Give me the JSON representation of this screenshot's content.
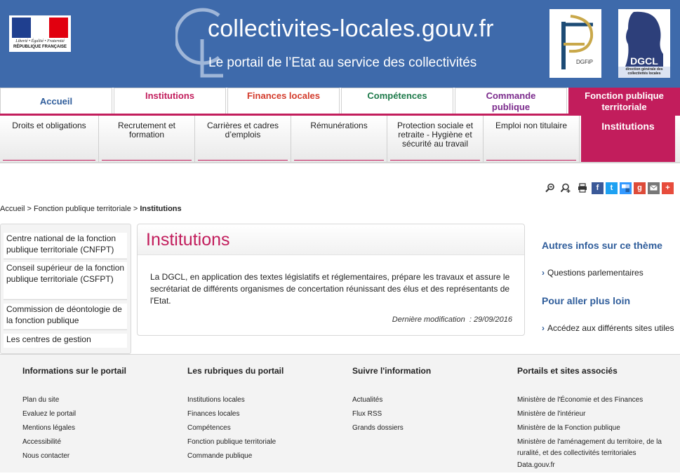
{
  "header": {
    "title": "collectivites-locales.gouv.fr",
    "subtitle": "Le portail de l’Etat au service des collectivités",
    "marianne_line1": "Liberté • Égalité • Fraternité",
    "marianne_line2": "RÉPUBLIQUE FRANÇAISE",
    "dgfip_label": "DGFiP",
    "dgcl_label": "DGCL",
    "dgcl_sub": "direction générale des collectivités locales"
  },
  "mainnav": [
    {
      "label": "Accueil",
      "color": "#2f5d9b"
    },
    {
      "label": "Institutions",
      "color": "#c21d5c"
    },
    {
      "label": "Finances locales",
      "color": "#d33b2b"
    },
    {
      "label": "Compétences",
      "color": "#1e7a4a"
    },
    {
      "label": "Commande publique",
      "color": "#7b2a8c"
    },
    {
      "label": "Fonction publique territoriale",
      "color": "#ffffff"
    }
  ],
  "subnav": [
    {
      "label": "Droits et obligations"
    },
    {
      "label": "Recrutement et formation"
    },
    {
      "label": "Carrières et cadres d’emplois"
    },
    {
      "label": "Rémunérations"
    },
    {
      "label": "Protection sociale et retraite - Hygiène et sécurité au travail"
    },
    {
      "label": "Emploi non titulaire"
    },
    {
      "label": "Institutions"
    }
  ],
  "breadcrumb": {
    "home": "Accueil",
    "sep": " > ",
    "section": "Fonction publique territoriale",
    "current": "Institutions"
  },
  "leftmenu": [
    {
      "label": "Centre national de la fonction publique territoriale (CNFPT)"
    },
    {
      "label": "Conseil supérieur de la fonction publique territoriale (CSFPT)"
    },
    {
      "label": "Commission de déontologie de la fonction publique"
    },
    {
      "label": "Les centres de gestion"
    }
  ],
  "content": {
    "title": "Institutions",
    "body": "La DGCL, en application des textes législatifs et réglementaires, prépare les travaux et assure le secrétariat de différents organismes de concertation réunissant des élus et des représentants de l'Etat.",
    "modified_label": "Dernière modification",
    "modified_date": "29/09/2016"
  },
  "right": {
    "themes_title": "Autres infos sur ce thème",
    "themes_link": "Questions parlementaires",
    "further_title": "Pour aller plus loin",
    "further_link": "Accédez aux différents sites utiles"
  },
  "toolbar": {
    "icons": [
      "zoom-out-icon",
      "zoom-in-icon",
      "print-icon",
      "facebook-icon",
      "twitter-icon",
      "delicious-icon",
      "google-plus-icon",
      "email-icon",
      "share-icon"
    ],
    "colors": {
      "facebook": "#3b5998",
      "twitter": "#1da1f2",
      "delicious": "#3399ff",
      "google": "#dd4b39",
      "email": "#777777",
      "share": "#e74c3c"
    }
  },
  "footer": {
    "columns": [
      {
        "title": "Informations sur le portail",
        "links": [
          "Plan du site",
          "Evaluez le portail",
          "Mentions légales",
          "Accessibilité",
          "Nous contacter"
        ]
      },
      {
        "title": "Les rubriques du portail",
        "links": [
          "Institutions locales",
          "Finances locales",
          "Compétences",
          "Fonction publique territoriale",
          "Commande publique"
        ]
      },
      {
        "title": "Suivre l'information",
        "links": [
          "Actualités",
          "Flux RSS",
          "Grands dossiers"
        ]
      },
      {
        "title": "Portails et sites associés",
        "links": [
          "Ministère de l'Économie et des Finances",
          "Ministère de l'intérieur",
          "Ministère de la Fonction publique",
          "Ministère de l'aménagement du territoire, de la ruralité, et des collectivités territoriales",
          "Data.gouv.fr"
        ]
      }
    ]
  }
}
